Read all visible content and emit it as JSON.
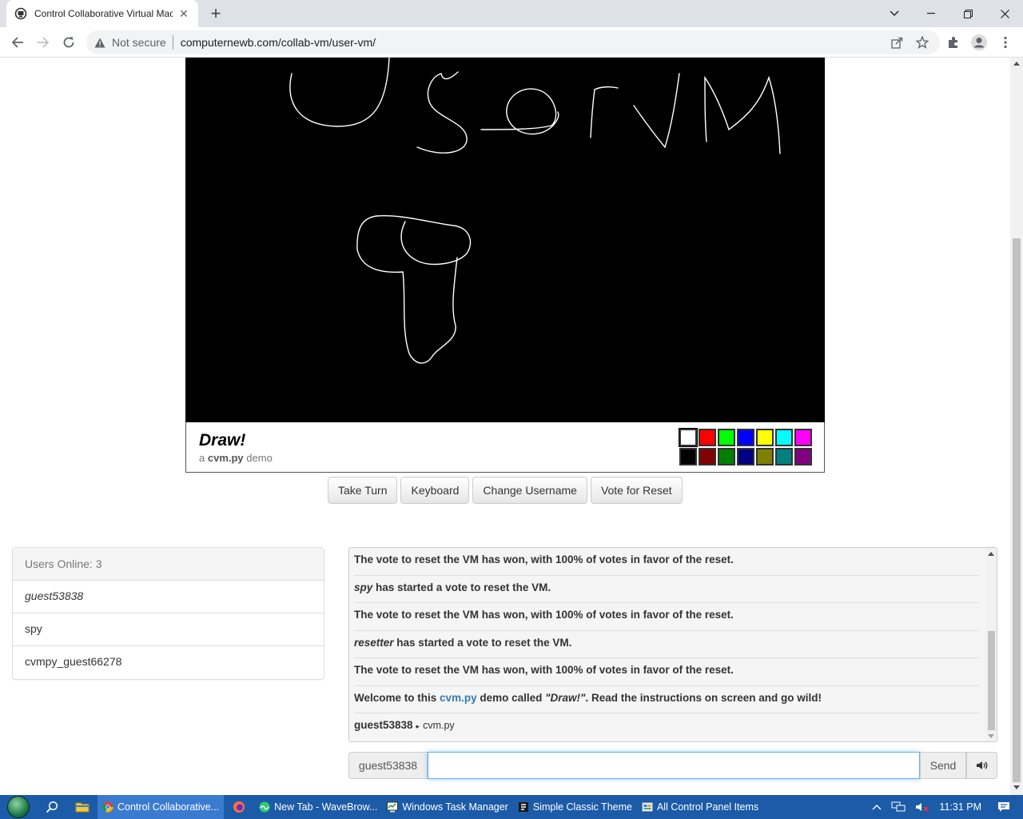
{
  "browser": {
    "tab_title": "Control Collaborative Virtual Machine",
    "not_secure": "Not secure",
    "url": "computernewb.com/collab-vm/user-vm/"
  },
  "vm": {
    "title": "Draw!",
    "sub_prefix": "a",
    "sub_brand": "cvm.py",
    "sub_suffix": "demo",
    "palette": [
      "#ffffff",
      "#ff0000",
      "#00ff00",
      "#0000ff",
      "#ffff00",
      "#00ffff",
      "#ff00ff",
      "#000000",
      "#800000",
      "#008000",
      "#000080",
      "#808000",
      "#008080",
      "#800080"
    ]
  },
  "buttons": {
    "take_turn": "Take Turn",
    "keyboard": "Keyboard",
    "change_username": "Change Username",
    "vote_reset": "Vote for Reset"
  },
  "users": {
    "header": "Users Online: 3",
    "list": [
      "guest53838",
      "spy",
      "cvmpy_guest66278"
    ]
  },
  "chat": {
    "messages": [
      {
        "text": "The vote to reset the VM has won, with 100% of votes in favor of the reset."
      },
      {
        "user": "spy",
        "text": "has started a vote to reset the VM."
      },
      {
        "text": "The vote to reset the VM has won, with 100% of votes in favor of the reset."
      },
      {
        "user": "resetter",
        "text": "has started a vote to reset the VM."
      },
      {
        "text": "The vote to reset the VM has won, with 100% of votes in favor of the reset."
      }
    ],
    "welcome": {
      "pre": "Welcome to this",
      "link": "cvm.py",
      "mid": "demo called",
      "name": "\"Draw!\"",
      "post": ". Read the instructions on screen and go wild!"
    },
    "last": {
      "user": "guest53838",
      "arrow": "▸",
      "text": "cvm.py"
    }
  },
  "input": {
    "nick": "guest53838",
    "value": "",
    "send": "Send"
  },
  "taskbar": {
    "tasks": [
      {
        "label": "Control Collaborative...",
        "active": true
      },
      {
        "label": "New Tab - WaveBrow...",
        "active": false
      },
      {
        "label": "Windows Task Manager",
        "active": false
      },
      {
        "label": "Simple Classic Theme",
        "active": false
      },
      {
        "label": "All Control Panel Items",
        "active": false
      }
    ],
    "time": "11:31 PM"
  }
}
